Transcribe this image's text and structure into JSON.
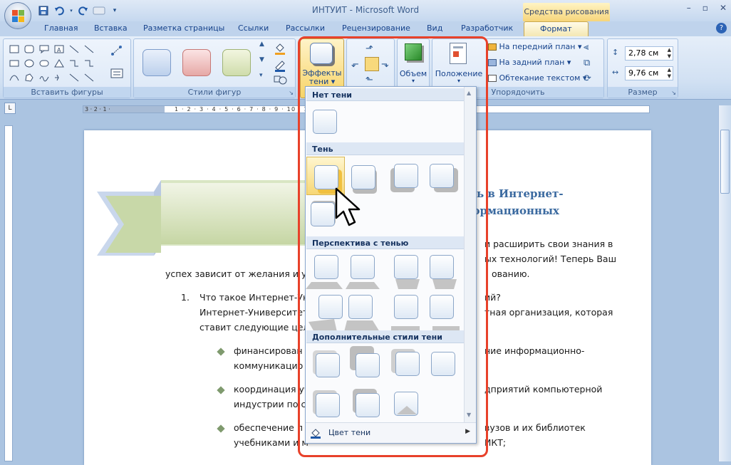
{
  "window": {
    "title": "ИНТУИТ - Microsoft Word",
    "context_tab_group": "Средства рисования",
    "controls": [
      "–",
      "▫",
      "✕"
    ]
  },
  "quick_access": [
    "save-icon",
    "undo-icon",
    "redo-icon",
    "repeat-icon"
  ],
  "tabs": [
    {
      "label": "Главная"
    },
    {
      "label": "Вставка"
    },
    {
      "label": "Разметка страницы"
    },
    {
      "label": "Ссылки"
    },
    {
      "label": "Рассылки"
    },
    {
      "label": "Рецензирование"
    },
    {
      "label": "Вид"
    },
    {
      "label": "Разработчик"
    },
    {
      "label": "Формат",
      "active": true
    }
  ],
  "ribbon": {
    "insert_shapes": {
      "label": "Вставить фигуры"
    },
    "shape_styles": {
      "label": "Стили фигур"
    },
    "shadow_effects": {
      "label_line1": "Эффекты",
      "label_line2": "тени"
    },
    "volume": {
      "label": "Объем"
    },
    "arrange": {
      "label": "Упорядочить",
      "position": "Положение",
      "bring_front": "На передний план",
      "send_back": "На задний план",
      "text_wrap": "Обтекание текстом"
    },
    "size": {
      "label": "Размер",
      "height": "2,78 см",
      "width": "9,76 см"
    }
  },
  "ruler": {
    "left_marks": "3 · 2 · 1 ·",
    "marks": "1 · 2 · 3 · 4 · 5 · 6 · 7 · 8 · 9 · 10 · 11 · 12 · 13 · 14 · 15 · 16 · 17"
  },
  "document": {
    "heading_line1": "ать в Интернет-",
    "heading_line2": "формационных",
    "text_right1": "и расширить свои знания в",
    "text_right2": "ых технологий! Теперь Ваш",
    "text_line3": "успех зависит от желания и уси",
    "text_line3_right": "ованию.",
    "item_number": "1.",
    "item_q_left": "Что такое Интернет-Ун",
    "item_q_right": "ий?",
    "item_a1_left": "Интернет-Университет",
    "item_a1_right": "тная организация, которая",
    "item_a2": "ставит следующие цели",
    "bullets": [
      {
        "left": "финансирован",
        "right": "ние информационно-",
        "line2_left": "коммуникацио",
        "line2_right": ""
      },
      {
        "left": "координация уч",
        "right": "дприятий компьютерной",
        "line2_left": "индустрии по со",
        "line2_right": ""
      },
      {
        "left": "обеспечение п",
        "right": "вузов и их библиотек",
        "line2_left": "учебниками и м",
        "line2_right": "ИКТ;"
      }
    ]
  },
  "gallery": {
    "section_no_shadow": "Нет тени",
    "section_shadow": "Тень",
    "section_perspective": "Перспектива с тенью",
    "section_additional": "Дополнительные стили тени",
    "footer_label": "Цвет тени"
  },
  "colors": {
    "accent_frame": "#e8412a",
    "ribbon_bg": "#d2e1f3",
    "heading": "#3b6aa0",
    "bullet": "#7f9a6e"
  }
}
